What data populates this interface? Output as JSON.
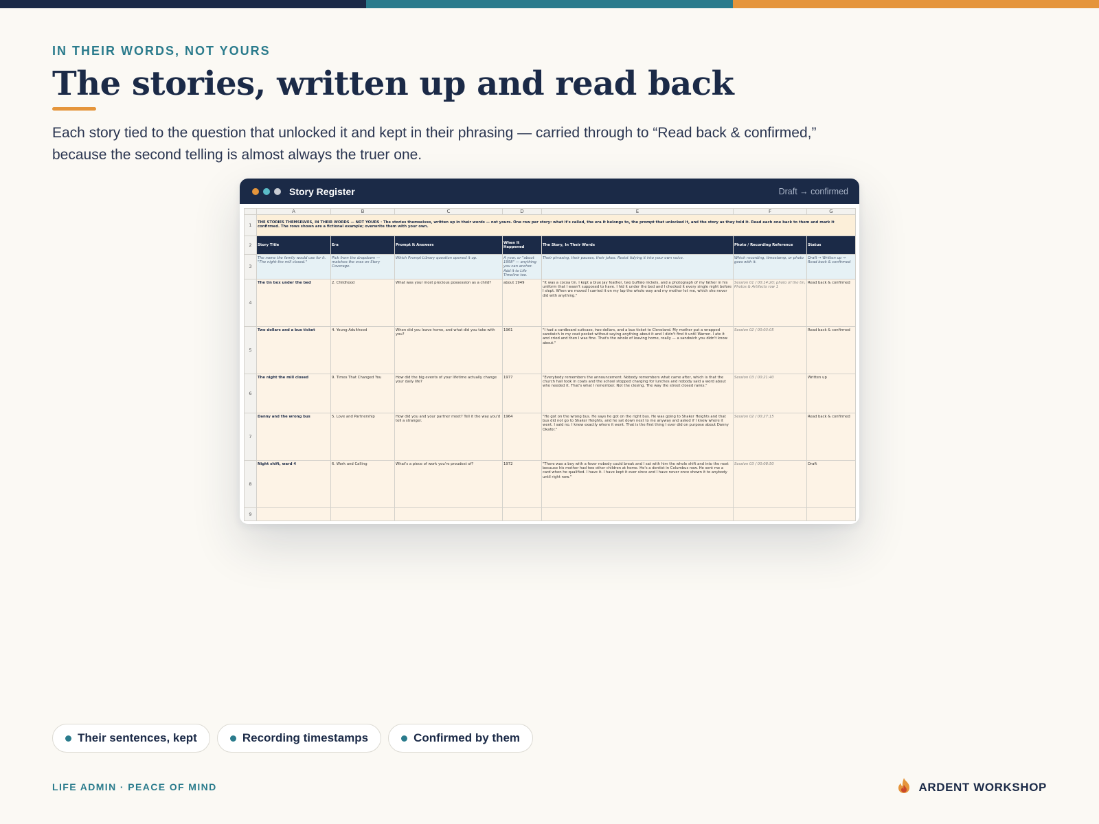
{
  "colors": {
    "navy": "#1b2a47",
    "teal": "#2a7b8c",
    "orange": "#e5953b",
    "background": "#fbf9f4"
  },
  "eyebrow": "IN THEIR WORDS, NOT YOURS",
  "title": "The stories, written up and read back",
  "subtitle": "Each story tied to the question that unlocked it and kept in their phrasing — carried through to “Read back & confirmed,” because the second telling is almost always the truer one.",
  "window": {
    "title": "Story Register",
    "status": "Draft → confirmed",
    "dot_colors": [
      "#e5953b",
      "#5bbcc8",
      "#c9ccd3"
    ]
  },
  "sheet": {
    "columns": [
      "A",
      "B",
      "C",
      "D",
      "E",
      "F",
      "G"
    ],
    "row_numbers": [
      "1",
      "2",
      "3",
      "4",
      "5",
      "6",
      "7",
      "8",
      "9"
    ],
    "banner": "THE STORIES THEMSELVES, IN THEIR WORDS — NOT YOURS · The stories themselves, written up in their words — not yours. One row per story: what it's called, the era it belongs to, the prompt that unlocked it, and the story as they told it. Read each one back to them and mark it confirmed. The rows shown are a fictional example; overwrite them with your own.",
    "headers": [
      "Story Title",
      "Era",
      "Prompt It Answers",
      "When It Happened",
      "The Story, In Their Words",
      "Photo / Recording Reference",
      "Status"
    ],
    "hints": [
      "The name the family would use for it. \"The night the mill closed.\"",
      "Pick from the dropdown — matches the eras on Story Coverage.",
      "Which Prompt Library question opened it up.",
      "A year, or \"about 1958\" — anything you can anchor. Add it to Life Timeline too.",
      "Their phrasing, their pauses, their jokes. Resist tidying it into your own voice.",
      "Which recording, timestamp, or photo goes with it.",
      "Draft → Written up → Read back & confirmed"
    ],
    "rows": [
      {
        "title": "The tin box under the bed",
        "era": "2. Childhood",
        "prompt": "What was your most precious possession as a child?",
        "when": "about 1949",
        "story": "\"It was a cocoa tin. I kept a blue jay feather, two buffalo nickels, and a photograph of my father in his uniform that I wasn't supposed to have. I hid it under the bed and I checked it every single night before I slept. When we moved I carried it on my lap the whole way and my mother let me, which she never did with anything.\"",
        "ref": "Session 01 / 00:14:20; photo of the tin, Photos & Artifacts row 1",
        "status": "Read back & confirmed"
      },
      {
        "title": "Two dollars and a bus ticket",
        "era": "4. Young Adulthood",
        "prompt": "When did you leave home, and what did you take with you?",
        "when": "1961",
        "story": "\"I had a cardboard suitcase, two dollars, and a bus ticket to Cleveland. My mother put a wrapped sandwich in my coat pocket without saying anything about it and I didn't find it until Warren. I ate it and cried and then I was fine. That's the whole of leaving home, really — a sandwich you didn't know about.\"",
        "ref": "Session 02 / 00:03:05",
        "status": "Read back & confirmed"
      },
      {
        "title": "The night the mill closed",
        "era": "9. Times That Changed You",
        "prompt": "How did the big events of your lifetime actually change your daily life?",
        "when": "1977",
        "story": "\"Everybody remembers the announcement. Nobody remembers what came after, which is that the church hall took in coats and the school stopped charging for lunches and nobody said a word about who needed it. That's what I remember. Not the closing. The way the street closed ranks.\"",
        "ref": "Session 03 / 00:21:40",
        "status": "Written up"
      },
      {
        "title": "Danny and the wrong bus",
        "era": "5. Love and Partnership",
        "prompt": "How did you and your partner meet? Tell it the way you'd tell a stranger.",
        "when": "1964",
        "story": "\"He got on the wrong bus. He says he got on the right bus. He was going to Shaker Heights and that bus did not go to Shaker Heights, and he sat down next to me anyway and asked if I knew where it went. I said no. I knew exactly where it went. That is the first thing I ever did on purpose about Danny Okafor.\"",
        "ref": "Session 02 / 00:27:15",
        "status": "Read back & confirmed"
      },
      {
        "title": "Night shift, ward 4",
        "era": "6. Work and Calling",
        "prompt": "What's a piece of work you're proudest of?",
        "when": "1972",
        "story": "\"There was a boy with a fever nobody could break and I sat with him the whole shift and into the next because his mother had two other children at home. He's a dentist in Columbus now. He sent me a card when he qualified. I have it. I have kept it ever since and I have never once shown it to anybody until right now.\"",
        "ref": "Session 03 / 00:08:50",
        "status": "Draft"
      }
    ]
  },
  "chips": [
    "Their sentences, kept",
    "Recording timestamps",
    "Confirmed by them"
  ],
  "footer": {
    "tagline": "LIFE ADMIN · PEACE OF MIND",
    "brand": "ARDENT WORKSHOP"
  },
  "icons": {
    "brand": "flame-icon",
    "chip": "dot-icon"
  }
}
